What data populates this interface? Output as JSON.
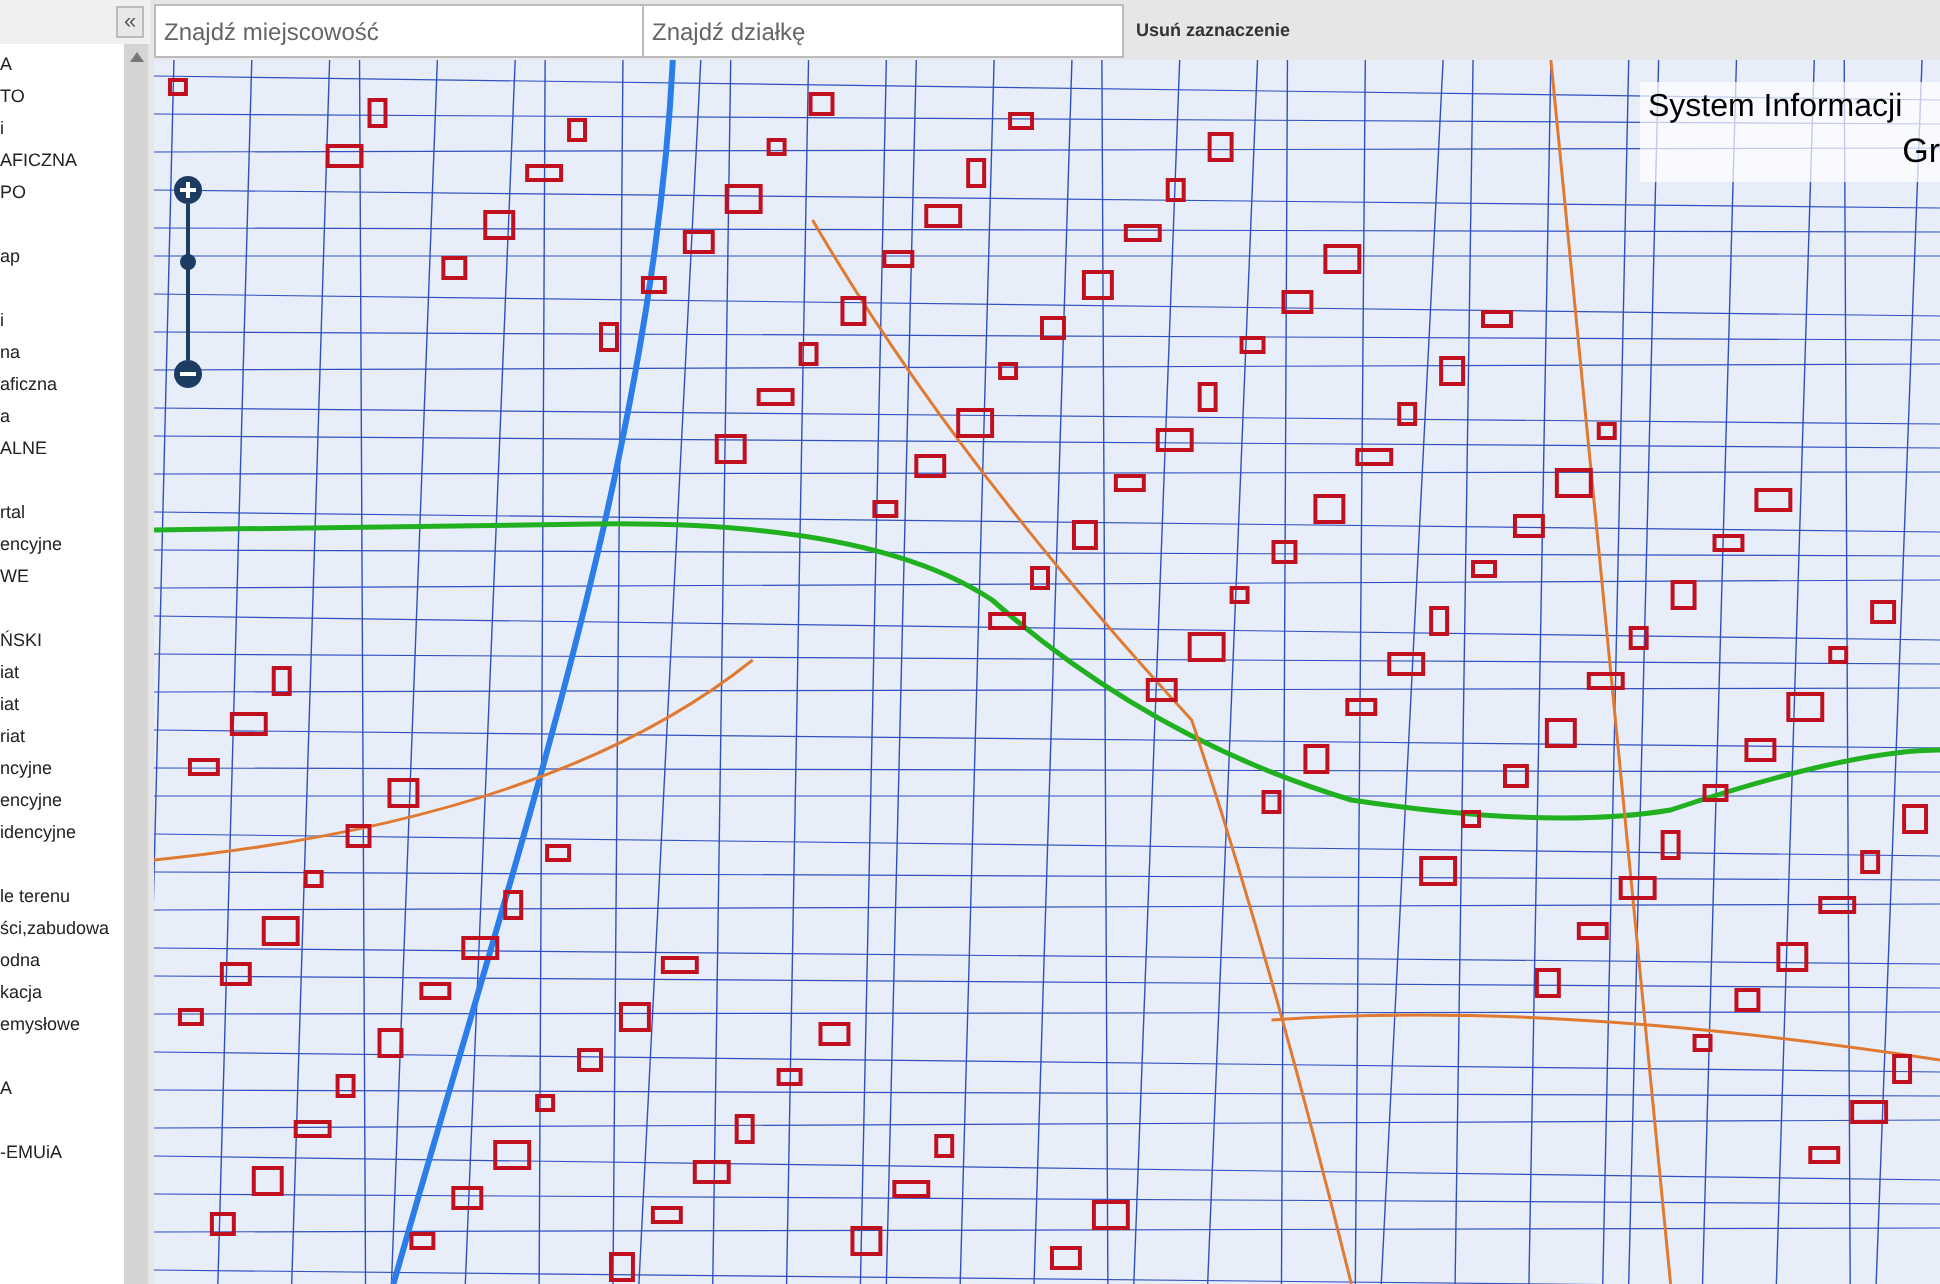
{
  "sidebar": {
    "collapse_button": "«",
    "groups": [
      {
        "items": [
          "A",
          "TO",
          "i",
          "AFICZNA",
          "PO"
        ]
      },
      {
        "items": [
          "ap"
        ]
      },
      {
        "items": [
          "i",
          "na",
          "aficzna",
          "a",
          "ALNE"
        ]
      },
      {
        "items": [
          "rtal",
          "encyjne",
          "WE"
        ]
      },
      {
        "items": [
          "ŃSKI",
          "iat",
          "iat",
          "riat",
          "ncyjne",
          "encyjne",
          "idencyjne"
        ]
      },
      {
        "items": [
          "le terenu",
          "ści,zabudowa",
          "odna",
          "kacja",
          "emysłowe"
        ]
      },
      {
        "items": [
          "A"
        ]
      },
      {
        "items": [
          "-EMUiA"
        ]
      }
    ]
  },
  "search": {
    "place_placeholder": "Znajdź miejscowość",
    "parcel_placeholder": "Znajdź działkę",
    "clear_button": "Usuń zaznaczenie"
  },
  "zoom": {
    "level": 0.65
  },
  "title_overlay": {
    "line_1": "System Informacji",
    "line_2": "Gr"
  }
}
